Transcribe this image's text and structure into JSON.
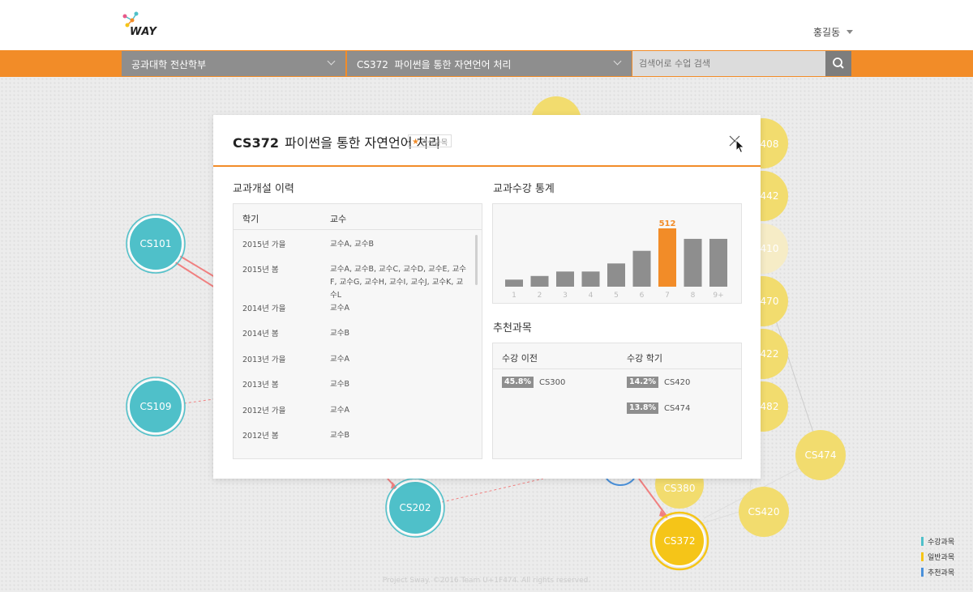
{
  "header": {
    "logo_text": "WAY",
    "user_name": "홍길동"
  },
  "nav": {
    "department": "공과대학 전산학부",
    "course": "CS372  파이썬을 통한 자연언어 처리",
    "search_placeholder": "검색어로 수업 검색"
  },
  "graph": {
    "nodes": [
      {
        "label": "CS101",
        "type": "수강과목"
      },
      {
        "label": "CS109",
        "type": "수강과목"
      },
      {
        "label": "CS202",
        "type": "수강과목"
      },
      {
        "label": "CS372",
        "type": "current"
      },
      {
        "label": "CS380",
        "type": "일반과목"
      },
      {
        "label": "CS420",
        "type": "일반과목"
      },
      {
        "label": "CS474",
        "type": "일반과목"
      },
      {
        "label": "408",
        "type": "일반과목"
      },
      {
        "label": "442",
        "type": "일반과목"
      },
      {
        "label": "410",
        "type": "일반과목"
      },
      {
        "label": "470",
        "type": "일반과목"
      },
      {
        "label": "422",
        "type": "일반과목"
      },
      {
        "label": "482",
        "type": "일반과목"
      }
    ]
  },
  "legend": [
    {
      "label": "수강과목",
      "color": "#4fc0c9"
    },
    {
      "label": "일반과목",
      "color": "#f5c518"
    },
    {
      "label": "추천과목",
      "color": "#4a90d9"
    }
  ],
  "footer": "Project Sway. ©2016 Team U+1F474. All rights reserved.",
  "modal": {
    "course_code": "CS372",
    "course_name": "파이썬을 통한 자연언어 처리",
    "favorite_label": "관심과목",
    "history_title": "교과개설 이력",
    "history_columns": [
      "학기",
      "교수"
    ],
    "history": [
      {
        "semester": "2015년 가을",
        "professors": "교수A, 교수B"
      },
      {
        "semester": "2015년 봄",
        "professors": "교수A, 교수B, 교수C, 교수D, 교수E, 교수F, 교수G, 교수H, 교수I, 교수J, 교수K, 교수L"
      },
      {
        "semester": "2014년 가을",
        "professors": "교수A"
      },
      {
        "semester": "2014년 봄",
        "professors": "교수B"
      },
      {
        "semester": "2013년 가을",
        "professors": "교수A"
      },
      {
        "semester": "2013년 봄",
        "professors": "교수B"
      },
      {
        "semester": "2012년 가을",
        "professors": "교수A"
      },
      {
        "semester": "2012년 봄",
        "professors": "교수B"
      }
    ],
    "stats_title": "교과수강 통계",
    "recommend_title": "추천과목",
    "recommend_columns": [
      "수강 이전",
      "수강 학기"
    ],
    "recommend_before": [
      {
        "percent": "45.8%",
        "course": "CS300"
      }
    ],
    "recommend_during": [
      {
        "percent": "14.2%",
        "course": "CS420"
      },
      {
        "percent": "13.8%",
        "course": "CS474"
      }
    ]
  },
  "chart_data": {
    "type": "bar",
    "categories": [
      "1",
      "2",
      "3",
      "4",
      "5",
      "6",
      "7",
      "8",
      "9+"
    ],
    "values": [
      62,
      94,
      133,
      133,
      204,
      315,
      512,
      420,
      420
    ],
    "highlight_index": 6,
    "highlight_label": "512",
    "ylim": [
      0,
      560
    ],
    "colors": {
      "default": "#8e8e8e",
      "highlight": "#f28c28"
    }
  }
}
